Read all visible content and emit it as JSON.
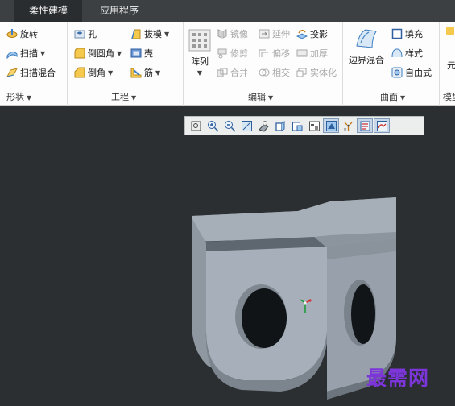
{
  "tabs": [
    {
      "label": "柔性建模",
      "active": true
    },
    {
      "label": "应用程序",
      "active": false
    }
  ],
  "ribbon": {
    "shape": {
      "label": "形状",
      "items": [
        "旋转",
        "扫描",
        "扫描混合"
      ]
    },
    "engineering": {
      "label": "工程",
      "items": [
        "孔",
        "倒圆角",
        "倒角",
        "拔模",
        "壳",
        "筋"
      ]
    },
    "editing": {
      "label": "编辑",
      "pattern": "阵列",
      "items": [
        "镜像",
        "延伸",
        "投影",
        "修剪",
        "偏移",
        "加厚",
        "合并",
        "相交",
        "实体化"
      ]
    },
    "surface": {
      "label": "曲面",
      "boundary_blend": "边界混合",
      "items": [
        "填充",
        "样式",
        "自由式"
      ]
    },
    "cut_right": {
      "item": "元",
      "group": "模型"
    }
  },
  "view_toolbar": {
    "buttons": [
      "refit-icon",
      "zoom-in-icon",
      "zoom-out-icon",
      "repaint-icon",
      "shading-icon",
      "shaded-edges-icon",
      "hidden-line-icon",
      "saved-views-icon",
      "view-manager-icon",
      "datum-display-icon",
      "spin-center-icon",
      "annotation-display-icon"
    ]
  },
  "watermark": "最需网",
  "colors": {
    "tab_bar": "#3d4043",
    "viewport": "#2b2f31",
    "model": "#9ea8b2",
    "watermark": "#7b35d8"
  }
}
